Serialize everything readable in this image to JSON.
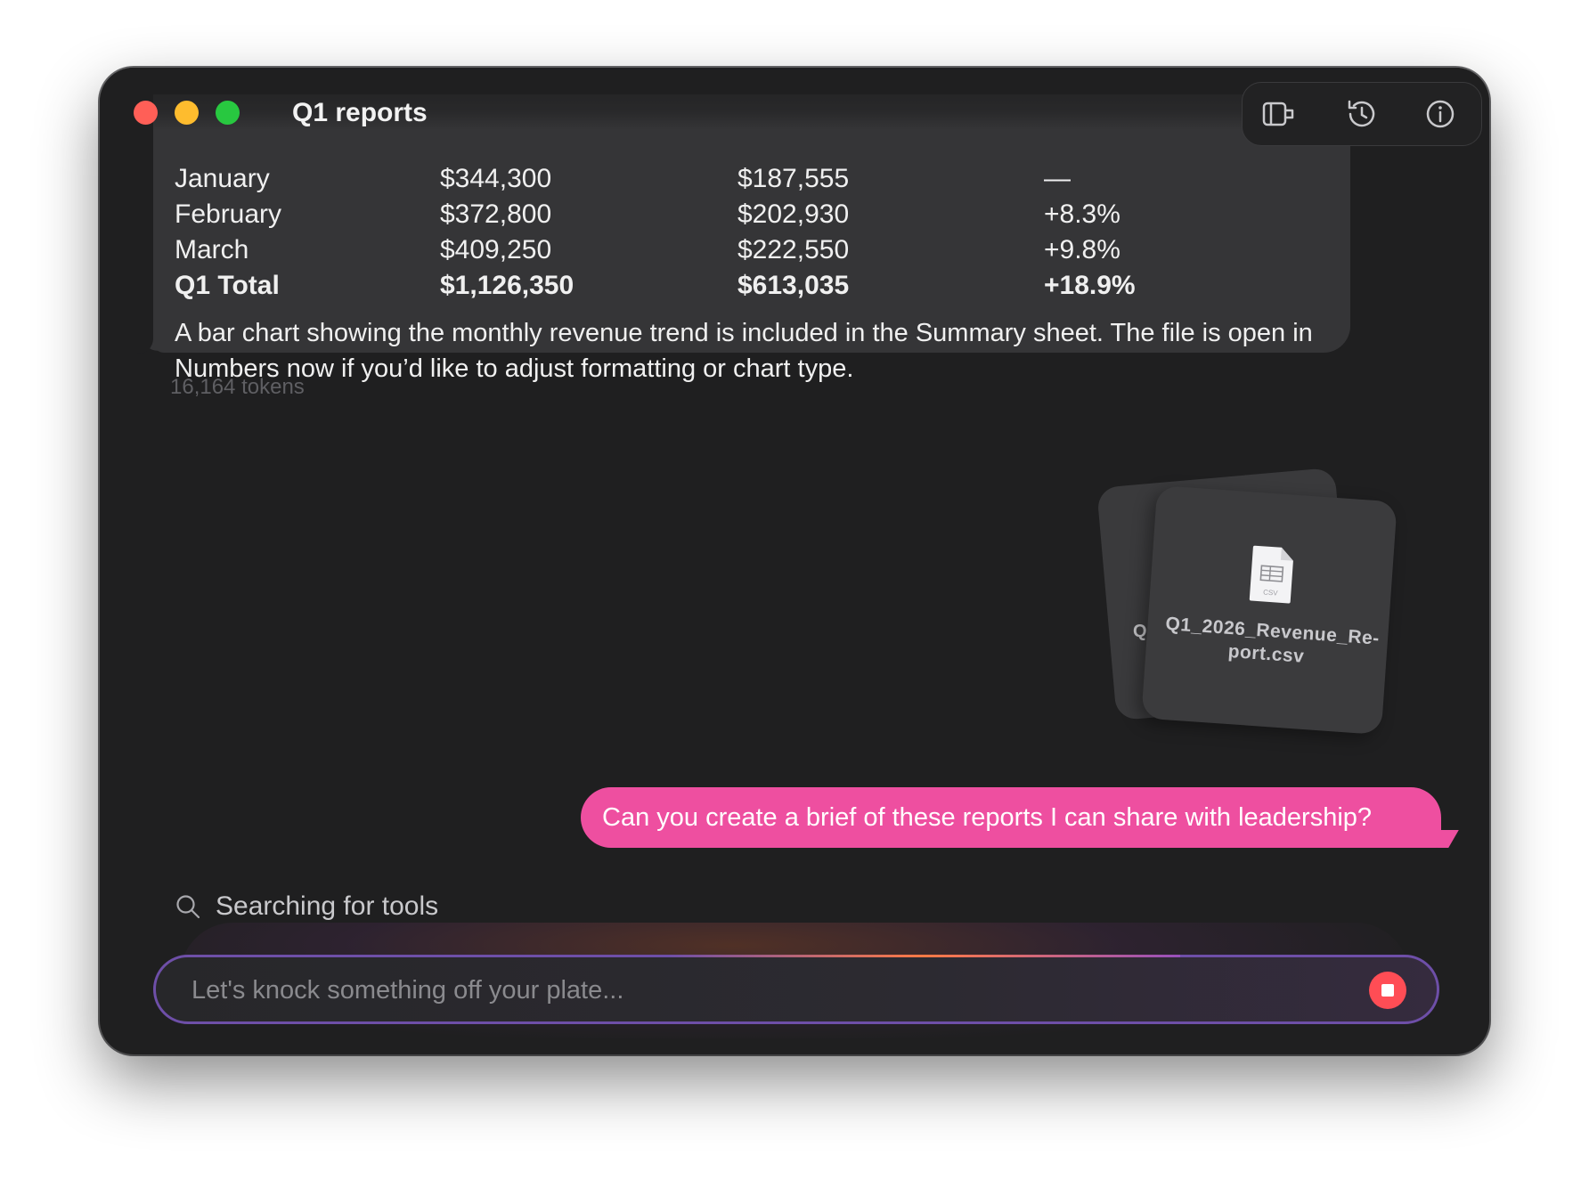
{
  "window": {
    "title": "Q1 reports"
  },
  "toolbar": {
    "icons": [
      "window-sidebar-icon",
      "history-icon",
      "info-icon"
    ]
  },
  "revenue_table": {
    "rows": [
      {
        "month": "January",
        "revenue": "$344,300",
        "profit": "$187,555",
        "change": "—"
      },
      {
        "month": "February",
        "revenue": "$372,800",
        "profit": "$202,930",
        "change": "+8.3%"
      },
      {
        "month": "March",
        "revenue": "$409,250",
        "profit": "$222,550",
        "change": "+9.8%"
      }
    ],
    "total": {
      "month": "Q1 Total",
      "revenue": "$1,126,350",
      "profit": "$613,035",
      "change": "+18.9%"
    }
  },
  "assistant_message": {
    "summary": "A bar chart showing the monthly revenue trend is included in the Summary sheet. The file is open in Numbers now if you’d like to adjust formatting or chart type.",
    "tokens": "16,164 tokens"
  },
  "attachments": {
    "back_letter": "Q",
    "front_name_line1": "Q1_2026_Revenue_Re-",
    "front_name_line2": "port.csv",
    "front_type": "CSV"
  },
  "user_message": "Can you create a brief of these reports I can share with leadership?",
  "status": {
    "text": "Searching for tools"
  },
  "composer": {
    "placeholder": "Let's knock something off your plate...",
    "value": ""
  },
  "colors": {
    "accent": "#ee4fa0",
    "stop": "#ff4d55",
    "background": "#1f1f20",
    "bubble": "#353537"
  }
}
